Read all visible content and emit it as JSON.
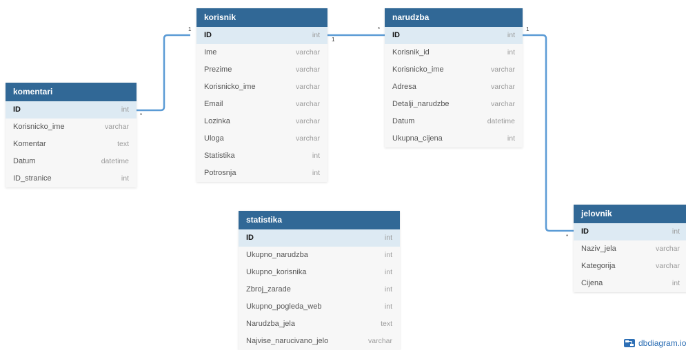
{
  "tables": {
    "korisnik": {
      "name": "korisnik",
      "columns": [
        {
          "name": "ID",
          "type": "int"
        },
        {
          "name": "Ime",
          "type": "varchar"
        },
        {
          "name": "Prezime",
          "type": "varchar"
        },
        {
          "name": "Korisnicko_ime",
          "type": "varchar"
        },
        {
          "name": "Email",
          "type": "varchar"
        },
        {
          "name": "Lozinka",
          "type": "varchar"
        },
        {
          "name": "Uloga",
          "type": "varchar"
        },
        {
          "name": "Statistika",
          "type": "int"
        },
        {
          "name": "Potrosnja",
          "type": "int"
        }
      ]
    },
    "narudzba": {
      "name": "narudzba",
      "columns": [
        {
          "name": "ID",
          "type": "int"
        },
        {
          "name": "Korisnik_id",
          "type": "int"
        },
        {
          "name": "Korisnicko_ime",
          "type": "varchar"
        },
        {
          "name": "Adresa",
          "type": "varchar"
        },
        {
          "name": "Detalji_narudzbe",
          "type": "varchar"
        },
        {
          "name": "Datum",
          "type": "datetime"
        },
        {
          "name": "Ukupna_cijena",
          "type": "int"
        }
      ]
    },
    "komentari": {
      "name": "komentari",
      "columns": [
        {
          "name": "ID",
          "type": "int"
        },
        {
          "name": "Korisnicko_ime",
          "type": "varchar"
        },
        {
          "name": "Komentar",
          "type": "text"
        },
        {
          "name": "Datum",
          "type": "datetime"
        },
        {
          "name": "ID_stranice",
          "type": "int"
        }
      ]
    },
    "statistika": {
      "name": "statistika",
      "columns": [
        {
          "name": "ID",
          "type": "int"
        },
        {
          "name": "Ukupno_narudzba",
          "type": "int"
        },
        {
          "name": "Ukupno_korisnika",
          "type": "int"
        },
        {
          "name": "Zbroj_zarade",
          "type": "int"
        },
        {
          "name": "Ukupno_pogleda_web",
          "type": "int"
        },
        {
          "name": "Narudzba_jela",
          "type": "text"
        },
        {
          "name": "Najvise_narucivano_jelo",
          "type": "varchar"
        }
      ]
    },
    "jelovnik": {
      "name": "jelovnik",
      "columns": [
        {
          "name": "ID",
          "type": "int"
        },
        {
          "name": "Naziv_jela",
          "type": "varchar"
        },
        {
          "name": "Kategorija",
          "type": "varchar"
        },
        {
          "name": "Cijena",
          "type": "int"
        }
      ]
    }
  },
  "cardinality": {
    "one": "1",
    "many": "*"
  },
  "brand": "dbdiagram.io",
  "colors": {
    "header": "#316896",
    "pk_row": "#ddeaf3",
    "link": "#5b9bd5"
  }
}
